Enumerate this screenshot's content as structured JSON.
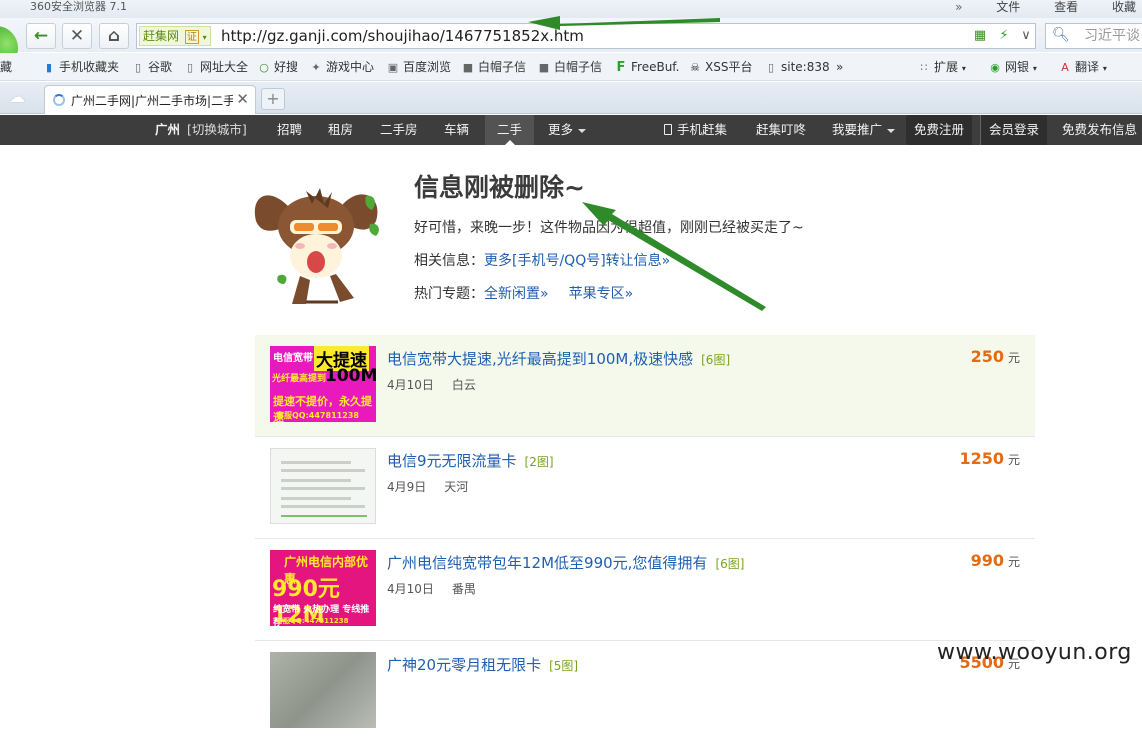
{
  "browser": {
    "title": "360安全浏览器 7.1",
    "menus": [
      "文件",
      "查看",
      "收藏"
    ],
    "menu_arrows": "»",
    "site_badge": "赶集网",
    "cert_badge": "证",
    "url": "http://gz.ganji.com/shoujihao/1467751852x.htm",
    "search_placeholder": "习近平谈",
    "tab_title": "广州二手网|广州二手市场|二手",
    "bookmarks": [
      "藏",
      "手机收藏夹",
      "谷歌",
      "网址大全",
      "好搜",
      "游戏中心",
      "百度浏览",
      "白帽子信",
      "白帽子信",
      "FreeBuf.",
      "XSS平台",
      "site:838",
      "»",
      "扩展",
      "网银",
      "翻译"
    ]
  },
  "nav": {
    "city": "广州",
    "switch_city": "[切换城市]",
    "items": [
      "招聘",
      "租房",
      "二手房",
      "车辆",
      "二手",
      "更多"
    ],
    "mobile": "手机赶集",
    "dingdong": "赶集叮咚",
    "promote": "我要推广",
    "register": "免费注册",
    "login": "会员登录",
    "post": "免费发布信息"
  },
  "notice": {
    "title": "信息刚被删除~",
    "message": "好可惜，来晚一步！这件物品因为很超值，刚刚已经被买走了~",
    "related_label": "相关信息：",
    "related_link": "更多[手机号/QQ号]转让信息»",
    "topics_label": "热门专题：",
    "topics": [
      "全新闲置»",
      "苹果专区»"
    ]
  },
  "listings": [
    {
      "title": "电信宽带大提速,光纤最高提到100M,极速快感",
      "pics": "[6图]",
      "date": "4月10日",
      "area": "白云",
      "price": "250",
      "unit": "元",
      "thumb_text": [
        "电信宽带",
        "大提速",
        "光纤最高提到",
        "100M",
        "提速不提价，永久提速",
        "客服QQ:447811238"
      ]
    },
    {
      "title": "电信9元无限流量卡",
      "pics": "[2图]",
      "date": "4月9日",
      "area": "天河",
      "price": "1250",
      "unit": "元"
    },
    {
      "title": "广州电信纯宽带包年12M低至990元,您值得拥有",
      "pics": "[6图]",
      "date": "4月10日",
      "area": "番禺",
      "price": "990",
      "unit": "元",
      "thumb_text": [
        "广州电信内部优惠",
        "990元12M",
        "纯宽带  火热办理  专线推荐",
        "客服QQ:447811238"
      ]
    },
    {
      "title": "广神20元零月租无限卡",
      "pics": "[5图]",
      "price": "5500",
      "unit": "元"
    }
  ],
  "watermark": "www.wooyun.org",
  "colors": {
    "nav_bg": "#3d3d3d",
    "link": "#1f5fb0",
    "price": "#e56a11",
    "highlight_row": "#f4f9ec",
    "arrow": "#2f8a2a"
  }
}
